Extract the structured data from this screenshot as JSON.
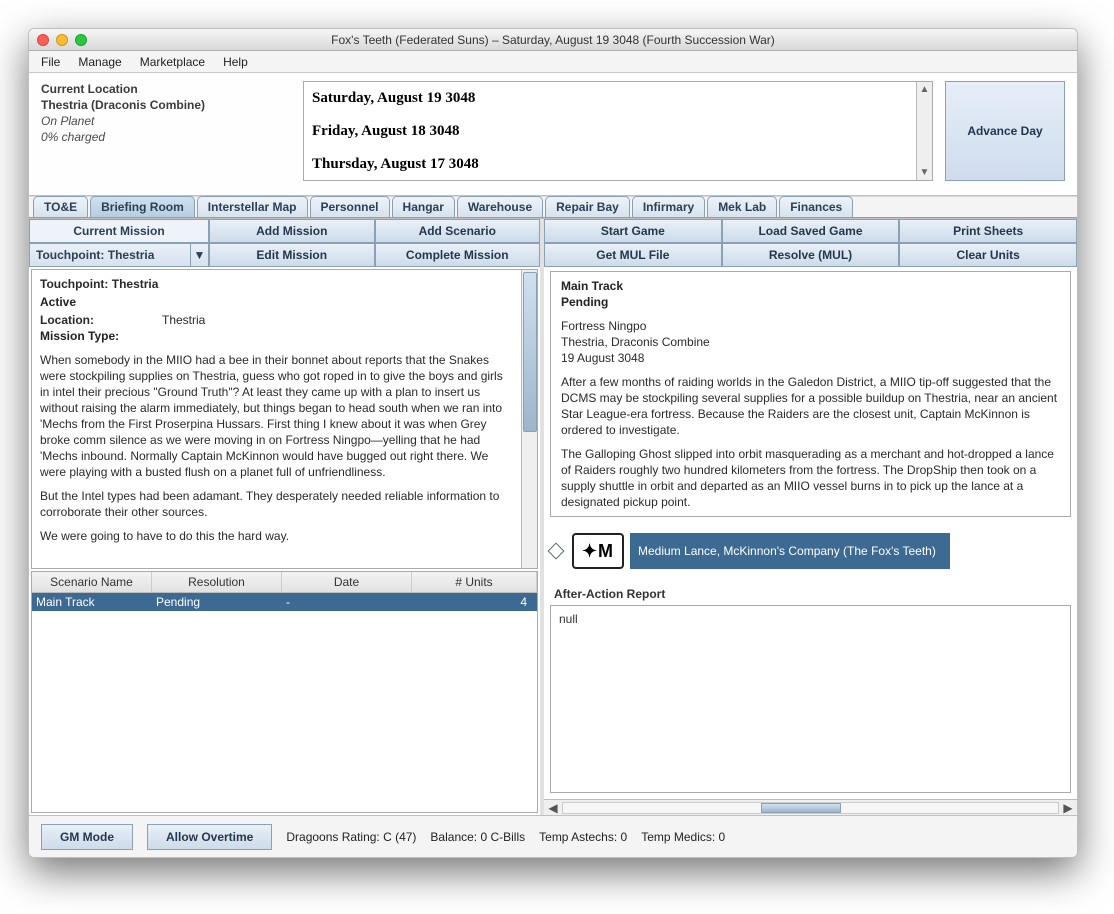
{
  "window": {
    "title": "Fox's Teeth (Federated Suns) – Saturday, August 19 3048 (Fourth Succession War)"
  },
  "menu": {
    "file": "File",
    "manage": "Manage",
    "marketplace": "Marketplace",
    "help": "Help"
  },
  "location": {
    "header": "Current Location",
    "planet": "Thestria (Draconis Combine)",
    "status": "On Planet",
    "charged": "0% charged"
  },
  "datelog": [
    "Saturday, August 19 3048",
    "Friday, August 18 3048",
    "Thursday, August 17 3048"
  ],
  "advance_day": "Advance Day",
  "tabs": {
    "toe": "TO&E",
    "briefing": "Briefing Room",
    "interstellar": "Interstellar Map",
    "personnel": "Personnel",
    "hangar": "Hangar",
    "warehouse": "Warehouse",
    "repair": "Repair Bay",
    "infirmary": "Infirmary",
    "meklab": "Mek Lab",
    "finances": "Finances"
  },
  "mission_bar": {
    "current_mission": "Current Mission",
    "selected": "Touchpoint: Thestria",
    "add_mission": "Add Mission",
    "add_scenario": "Add Scenario",
    "edit_mission": "Edit Mission",
    "complete_mission": "Complete Mission"
  },
  "mission_desc": {
    "title": "Touchpoint: Thestria",
    "status": "Active",
    "location_label": "Location:",
    "location_value": "Thestria",
    "type_label": "Mission Type:",
    "body1": "When somebody in the MIIO had a bee in their bonnet about reports that the Snakes were stockpiling supplies on Thestria, guess who got roped in to give the boys and girls in intel their precious \"Ground Truth\"? At least they came up with a plan to insert us without raising the alarm immediately, but things began to head south when we ran into 'Mechs from the First Proserpina Hussars. First thing I knew about it was when Grey broke comm silence as we were moving in on Fortress Ningpo—yelling that he had 'Mechs inbound. Normally Captain McKinnon would have bugged out right there. We were playing with a busted flush on a planet full of unfriendliness.",
    "body2": "But the Intel types had been adamant. They desperately needed reliable information to corroborate their other sources.",
    "body3": "We were going to have to do this the hard way."
  },
  "scenario_table": {
    "headers": {
      "name": "Scenario Name",
      "resolution": "Resolution",
      "date": "Date",
      "units": "# Units"
    },
    "row": {
      "name": "Main Track",
      "resolution": "Pending",
      "date": "-",
      "units": "4"
    }
  },
  "right_buttons": {
    "start_game": "Start Game",
    "load_saved": "Load Saved Game",
    "print_sheets": "Print Sheets",
    "get_mul": "Get MUL File",
    "resolve_mul": "Resolve (MUL)",
    "clear_units": "Clear Units"
  },
  "track_panel": {
    "title": "Main Track",
    "status": "Pending",
    "loc1": "Fortress Ningpo",
    "loc2": "Thestria, Draconis Combine",
    "date": "19 August 3048",
    "p1": "After a few months of raiding worlds in the Galedon District, a MIIO tip-off suggested that the DCMS may be stockpiling several supplies for a possible buildup on Thestria, near an ancient Star League-era fortress. Because the Raiders are the closest unit, Captain McKinnon is ordered to investigate.",
    "p2": "The Galloping Ghost slipped into orbit masquerading as a merchant and hot-dropped a lance of Raiders roughly two hundred kilometers from the fortress. The DropShip then took on a supply shuttle in orbit and departed as an MIIO vessel burns in to pick up the lance at a designated pickup point."
  },
  "lance": {
    "icon_text": "✦M",
    "label": "Medium Lance, McKinnon's Company (The Fox's Teeth)"
  },
  "aar": {
    "label": "After-Action Report",
    "value": "null"
  },
  "statusbar": {
    "gm_mode": "GM Mode",
    "allow_overtime": "Allow Overtime",
    "dragoons": "Dragoons Rating: C (47)",
    "balance": "Balance: 0 C-Bills",
    "temp_astechs": "Temp Astechs: 0",
    "temp_medics": "Temp Medics: 0"
  }
}
